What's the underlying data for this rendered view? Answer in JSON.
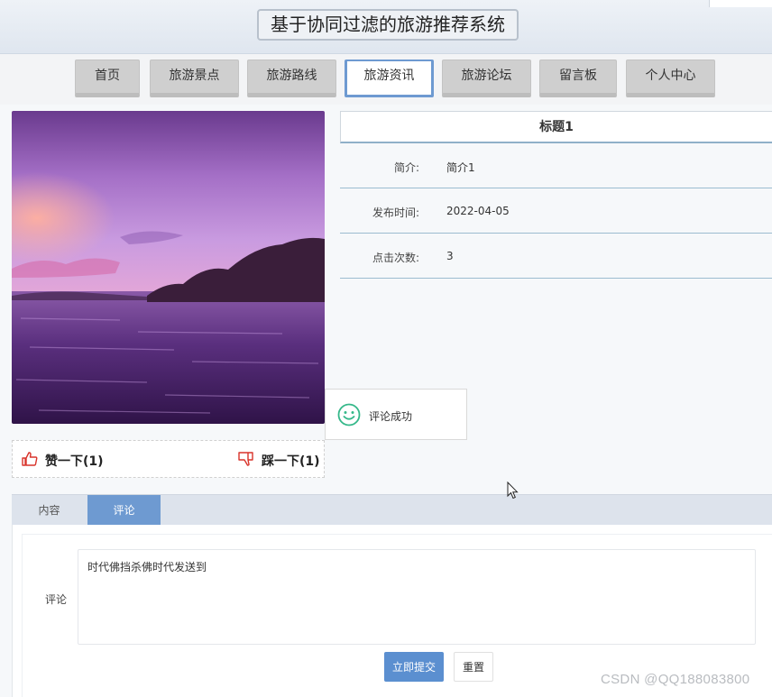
{
  "header": {
    "title": "基于协同过滤的旅游推荐系统"
  },
  "nav": {
    "items": [
      {
        "label": "首页",
        "active": false
      },
      {
        "label": "旅游景点",
        "active": false
      },
      {
        "label": "旅游路线",
        "active": false
      },
      {
        "label": "旅游资讯",
        "active": true
      },
      {
        "label": "旅游论坛",
        "active": false
      },
      {
        "label": "留言板",
        "active": false
      },
      {
        "label": "个人中心",
        "active": false
      }
    ]
  },
  "article": {
    "title": "标题1",
    "fields": [
      {
        "label": "简介:",
        "value": "简介1"
      },
      {
        "label": "发布时间:",
        "value": "2022-04-05"
      },
      {
        "label": "点击次数:",
        "value": "3"
      }
    ]
  },
  "toast": {
    "message": "评论成功",
    "icon": "smile-icon"
  },
  "votes": {
    "like_label": "赞一下(1)",
    "dislike_label": "踩一下(1)"
  },
  "tabs": [
    {
      "label": "内容",
      "active": false
    },
    {
      "label": "评论",
      "active": true
    }
  ],
  "comment_form": {
    "label": "评论",
    "value": "时代佛挡杀佛时代发送到",
    "submit_label": "立即提交",
    "reset_label": "重置"
  },
  "watermark": "CSDN @QQ188083800",
  "colors": {
    "accent": "#6e9ad1",
    "submit": "#5b8fd0",
    "like_icon": "#d9342b",
    "toast_icon": "#35b88a"
  }
}
